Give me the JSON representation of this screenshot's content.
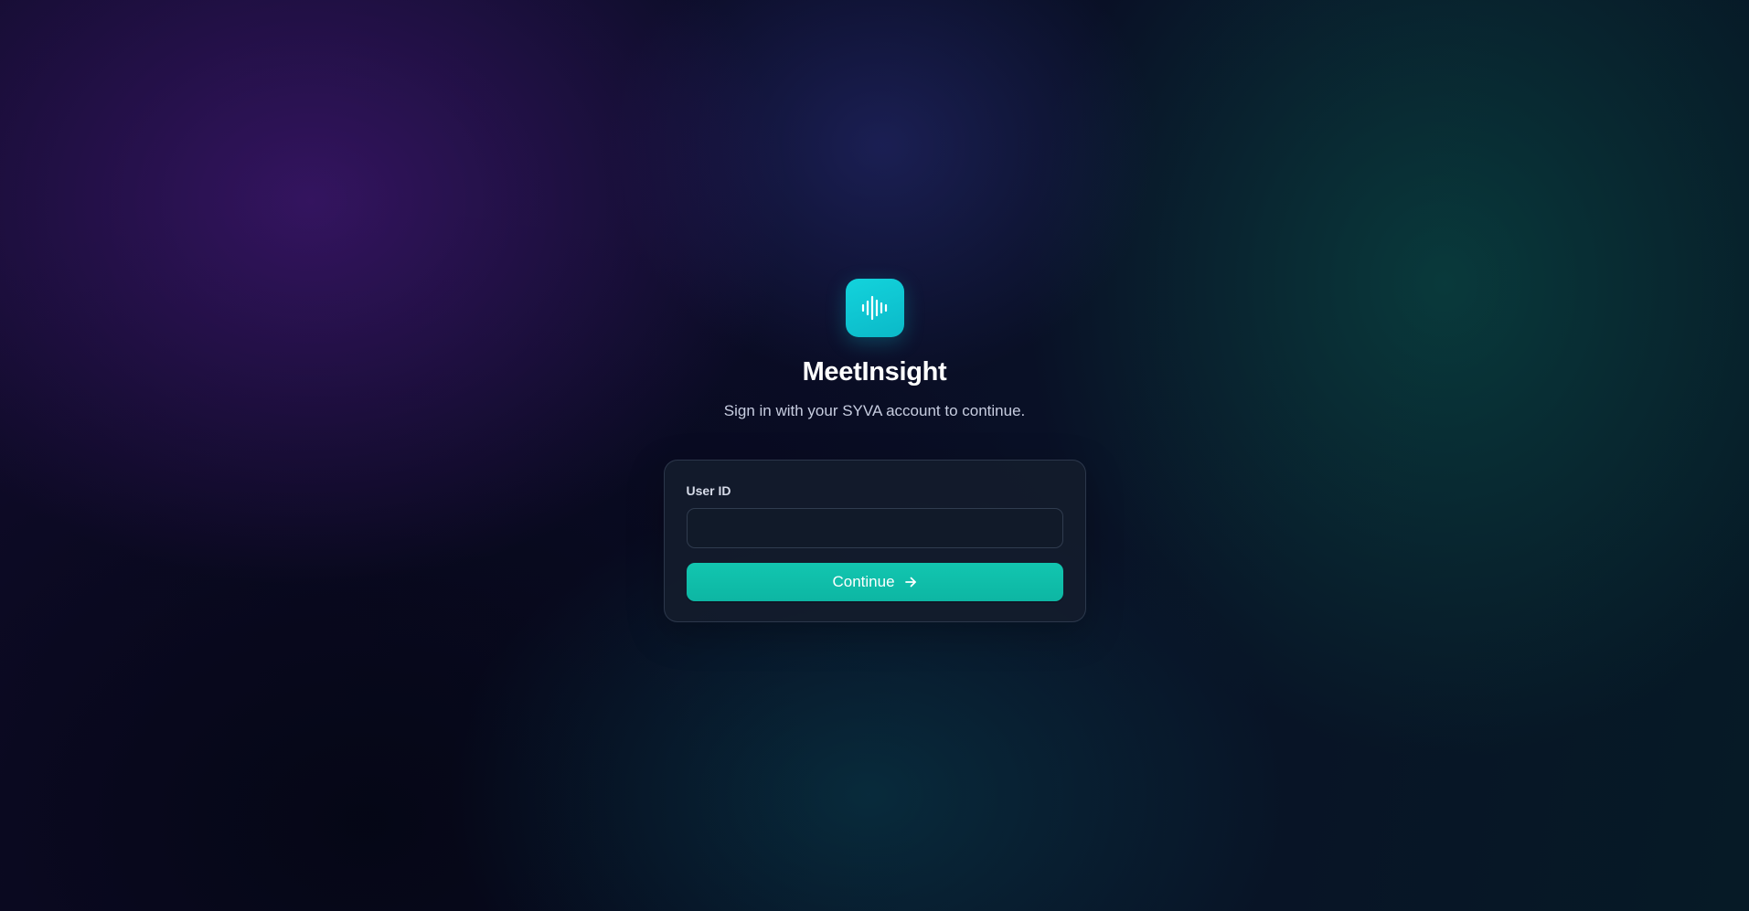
{
  "app": {
    "title": "MeetInsight",
    "subtitle": "Sign in with your SYVA account to continue.",
    "logo_icon": "sound-wave-icon",
    "accent_color": "#10c3b0",
    "logo_color": "#10c8d6"
  },
  "form": {
    "user_id_label": "User ID",
    "user_id_value": "",
    "user_id_placeholder": "",
    "continue_label": "Continue",
    "continue_icon": "arrow-right-icon"
  }
}
